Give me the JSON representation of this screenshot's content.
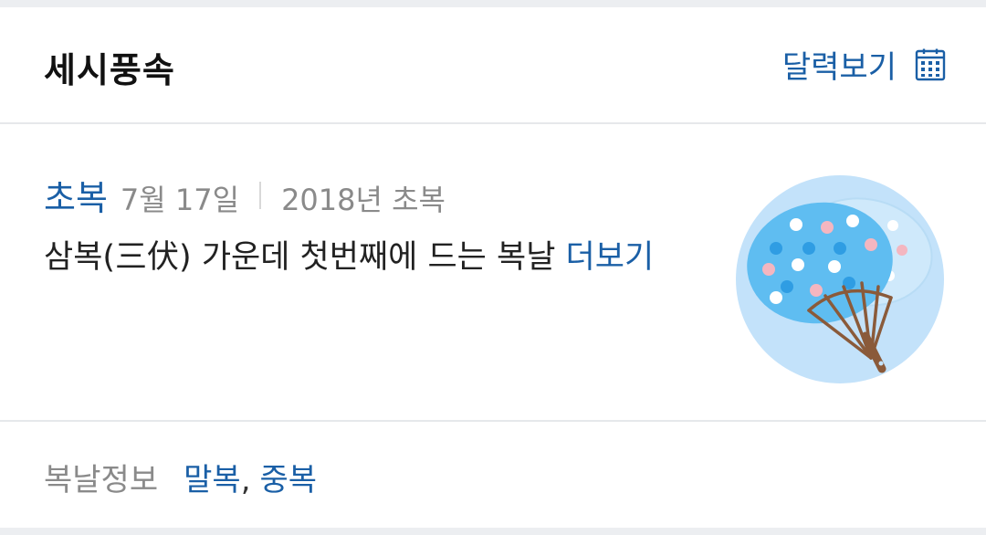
{
  "header": {
    "title": "세시풍속",
    "calendar_label": "달력보기",
    "calendar_icon": "calendar-icon"
  },
  "entry": {
    "name": "초복",
    "date": "7월 17일",
    "year_label": "2018년 초복",
    "description": "삼복(三伏) 가운데 첫번째에 드는 복날 ",
    "more_label": "더보기",
    "thumbnail_icon": "paper-fan-icon"
  },
  "footer": {
    "label": "복날정보",
    "links": [
      "말복",
      "중복"
    ],
    "separator": ","
  },
  "colors": {
    "accent": "#1a5fa6",
    "muted": "#8a8a8a",
    "divider": "#e6e8eb"
  }
}
